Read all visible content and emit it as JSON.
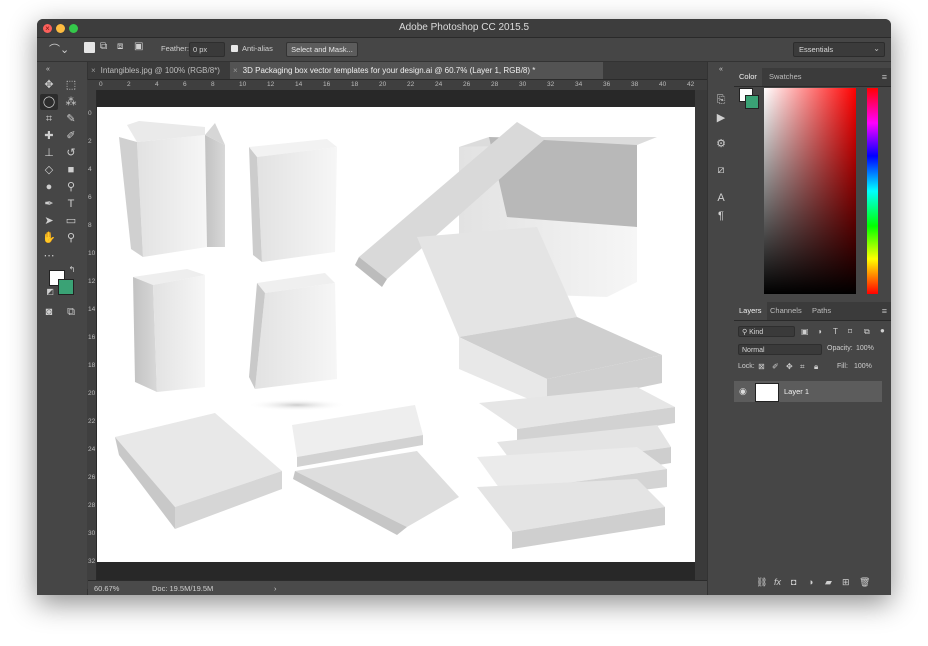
{
  "window": {
    "title": "Adobe Photoshop CC 2015.5"
  },
  "options_bar": {
    "feather_label": "Feather:",
    "feather_value": "0 px",
    "antialias_label": "Anti-alias",
    "select_mask_button": "Select and Mask...",
    "workspace": "Essentials"
  },
  "tabs": [
    {
      "label": "Intangibles.jpg @ 100% (RGB/8*)",
      "active": false
    },
    {
      "label": "3D Packaging box vector templates for your design.ai @ 60.7% (Layer 1, RGB/8) *",
      "active": true
    }
  ],
  "ruler": {
    "h_ticks": [
      "0",
      "2",
      "4",
      "6",
      "8",
      "10",
      "12",
      "14",
      "16",
      "18",
      "20",
      "22",
      "24",
      "26",
      "28",
      "30",
      "32",
      "34",
      "36",
      "38",
      "40",
      "42"
    ],
    "v_ticks": [
      "0",
      "2",
      "4",
      "6",
      "8",
      "10",
      "12",
      "14",
      "16",
      "18",
      "20",
      "22",
      "24",
      "26",
      "28",
      "30",
      "32"
    ]
  },
  "status": {
    "zoom": "60.67%",
    "doc": "Doc: 19.5M/19.5M"
  },
  "color_panel": {
    "tabs": [
      "Color",
      "Swatches"
    ],
    "fg_color": "#ffffff",
    "bg_color": "#3aa275"
  },
  "layers_panel": {
    "tabs": [
      "Layers",
      "Channels",
      "Paths"
    ],
    "filter": "Kind",
    "blend_mode": "Normal",
    "opacity_label": "Opacity:",
    "opacity_value": "100%",
    "lock_label": "Lock:",
    "fill_label": "Fill:",
    "fill_value": "100%",
    "layers": [
      {
        "name": "Layer 1",
        "visible": true
      }
    ]
  },
  "colors": {
    "accent_bg": "#3aa275",
    "panel": "#535353",
    "dark": "#282828"
  }
}
